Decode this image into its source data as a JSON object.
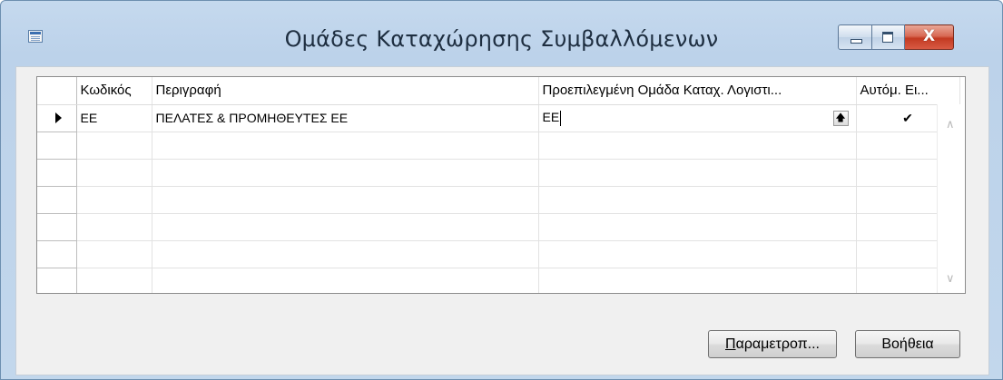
{
  "window": {
    "title": "Ομάδες Καταχώρησης Συμβαλλόμενων",
    "close_symbol": "X",
    "icons": [
      "app-icon",
      "minimize-icon",
      "maximize-icon",
      "close-icon"
    ]
  },
  "grid": {
    "columns": [
      {
        "key": "code",
        "label": "Κωδικός"
      },
      {
        "key": "description",
        "label": "Περιγραφή"
      },
      {
        "key": "default_group",
        "label": "Προεπιλεγμένη Ομάδα Καταχ. Λογιστι..."
      },
      {
        "key": "auto",
        "label": "Αυτόμ. Ει..."
      }
    ],
    "rows": [
      {
        "code": "ΕΕ",
        "description": "ΠΕΛΑΤΕΣ & ΠΡΟΜΗΘΕΥΤΕΣ ΕΕ",
        "default_group": "ΕΕ",
        "auto": "✔",
        "current": true
      },
      {
        "code": "",
        "description": "",
        "default_group": "",
        "auto": ""
      },
      {
        "code": "",
        "description": "",
        "default_group": "",
        "auto": ""
      },
      {
        "code": "",
        "description": "",
        "default_group": "",
        "auto": ""
      },
      {
        "code": "",
        "description": "",
        "default_group": "",
        "auto": ""
      },
      {
        "code": "",
        "description": "",
        "default_group": "",
        "auto": ""
      },
      {
        "code": "",
        "description": "",
        "default_group": "",
        "auto": ""
      }
    ],
    "lookup_symbol": "🠕"
  },
  "buttons": {
    "options_label": "Παραμετροπ...",
    "options_accel": "Π",
    "options_rest": "αραμετροπ...",
    "help_label": "Βοήθεια"
  }
}
